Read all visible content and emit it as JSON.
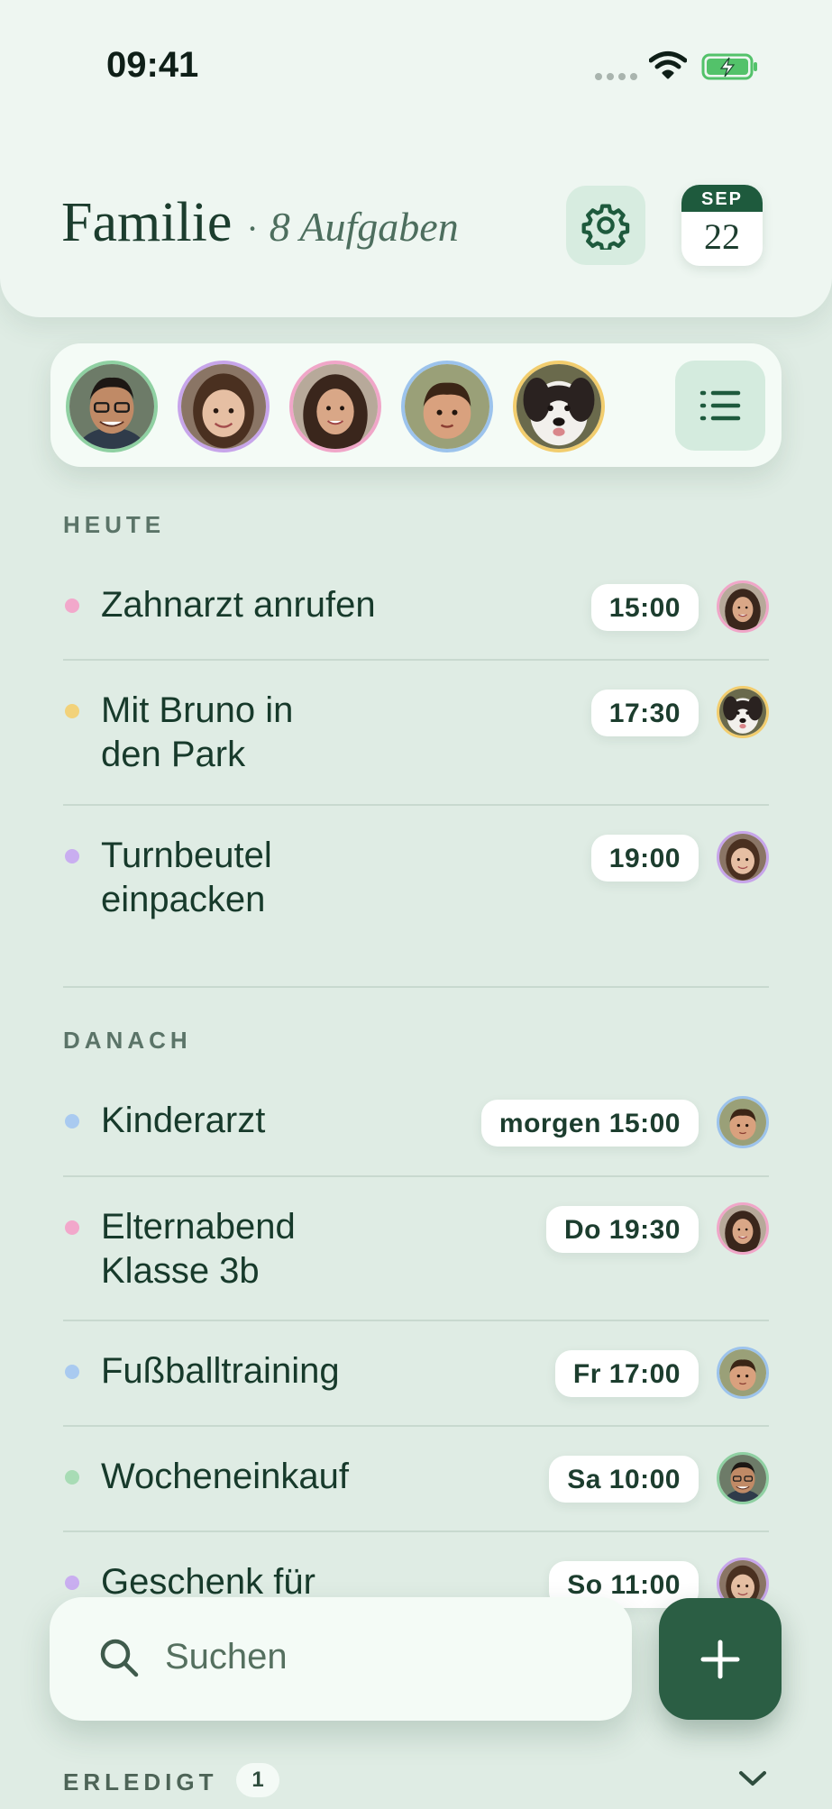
{
  "status": {
    "time": "09:41"
  },
  "header": {
    "title": "Familie",
    "separator": "·",
    "subtitle": "8 Aufgaben",
    "date_month": "SEP",
    "date_day": "22"
  },
  "members": [
    {
      "id": "dad",
      "ring": "#8fd0a2"
    },
    {
      "id": "girl",
      "ring": "#c7a5ea"
    },
    {
      "id": "mom",
      "ring": "#f0a6c8"
    },
    {
      "id": "boy",
      "ring": "#9cc3ec"
    },
    {
      "id": "dog",
      "ring": "#f2cd6e"
    }
  ],
  "sections": {
    "today": "HEUTE",
    "later": "DANACH",
    "done": "ERLEDIGT",
    "done_count": "1"
  },
  "tasks_today": [
    {
      "name": "Zahnarzt anrufen",
      "time": "15:00",
      "dot": "#f2a8cb",
      "member": "mom"
    },
    {
      "name": "Mit Bruno in\nden Park",
      "time": "17:30",
      "dot": "#f2d27a",
      "member": "dog"
    },
    {
      "name": "Turnbeutel\neinpacken",
      "time": "19:00",
      "dot": "#c9aef0",
      "member": "girl"
    }
  ],
  "tasks_later": [
    {
      "name": "Kinderarzt",
      "time": "morgen 15:00",
      "dot": "#a9caf0",
      "member": "boy"
    },
    {
      "name": "Elternabend\nKlasse 3b",
      "time": "Do 19:30",
      "dot": "#f2a8cb",
      "member": "mom"
    },
    {
      "name": "Fußballtraining",
      "time": "Fr 17:00",
      "dot": "#a9caf0",
      "member": "boy"
    },
    {
      "name": "Wocheneinkauf",
      "time": "Sa 10:00",
      "dot": "#a8dcb5",
      "member": "dad"
    },
    {
      "name": "Geschenk für",
      "time": "So 11:00",
      "dot": "#c9aef0",
      "member": "girl"
    }
  ],
  "search": {
    "placeholder": "Suchen"
  },
  "colors": {
    "accent": "#2b5e44",
    "background": "#dfece4"
  },
  "icons": {
    "settings": "gear-icon",
    "list": "list-icon",
    "search": "search-icon",
    "add": "plus-icon",
    "expand": "chevron-down-icon"
  }
}
